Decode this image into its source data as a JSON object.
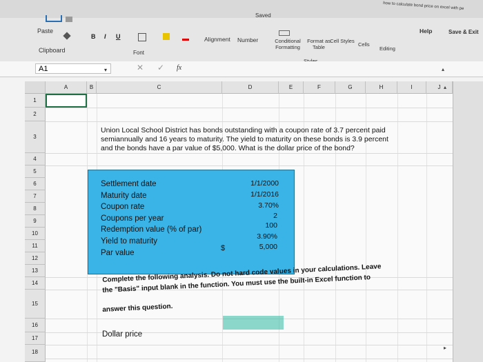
{
  "window": {
    "saved_label": "Saved",
    "top_right_text": "how to calculate bond price on excel with pe"
  },
  "ribbon": {
    "paste_label": "Paste",
    "clipboard_label": "Clipboard",
    "bold": "B",
    "italic": "I",
    "underline": "U",
    "font_label": "Font",
    "alignment_label": "Alignment",
    "number_label": "Number",
    "conditional_formatting_label": "Conditional Formatting",
    "format_as_table_label": "Format as Table",
    "cell_styles_label": "Cell Styles",
    "styles_label": "Styles",
    "cells_label": "Cells",
    "editing_label": "Editing",
    "help_label": "Help",
    "save_exit_label": "Save & Exit",
    "fx_label": "fx"
  },
  "formula_bar": {
    "name_box": "A1"
  },
  "columns": [
    "A",
    "B",
    "C",
    "D",
    "E",
    "F",
    "G",
    "H",
    "I",
    "J"
  ],
  "rows": [
    "1",
    "2",
    "3",
    "4",
    "5",
    "6",
    "7",
    "8",
    "9",
    "10",
    "11",
    "12",
    "13",
    "14",
    "15",
    "16",
    "17",
    "18"
  ],
  "problem": {
    "line1": "Union Local School District has bonds outstanding with a coupon rate of 3.7 percent paid",
    "line2": "semiannually and 16 years to maturity. The yield to maturity on these bonds is 3.9 percent",
    "line3": "and the bonds have a par value of $5,000. What is the dollar price of the bond?"
  },
  "inputs": {
    "settlement_label": "Settlement date",
    "settlement_value": "1/1/2000",
    "maturity_label": "Maturity date",
    "maturity_value": "1/1/2016",
    "coupon_label": "Coupon rate",
    "coupon_value": "3.70%",
    "cpy_label": "Coupons per year",
    "cpy_value": "2",
    "redemption_label": "Redemption value (% of par)",
    "redemption_value": "100",
    "ytm_label": "Yield to maturity",
    "ytm_value": "3.90%",
    "par_label": "Par value",
    "par_currency": "$",
    "par_value": "5,000"
  },
  "instructions": {
    "line1": "Complete the following analysis. Do not hard code values in your calculations. Leave",
    "line2": "the \"Basis\" input blank in the function. You must use the built-in Excel function to",
    "line3": "answer this question."
  },
  "answer": {
    "label": "Dollar price"
  },
  "colors": {
    "input_box": "#3ab3e6",
    "selection": "#1e7145",
    "answer_cell": "#2fb9a0"
  }
}
